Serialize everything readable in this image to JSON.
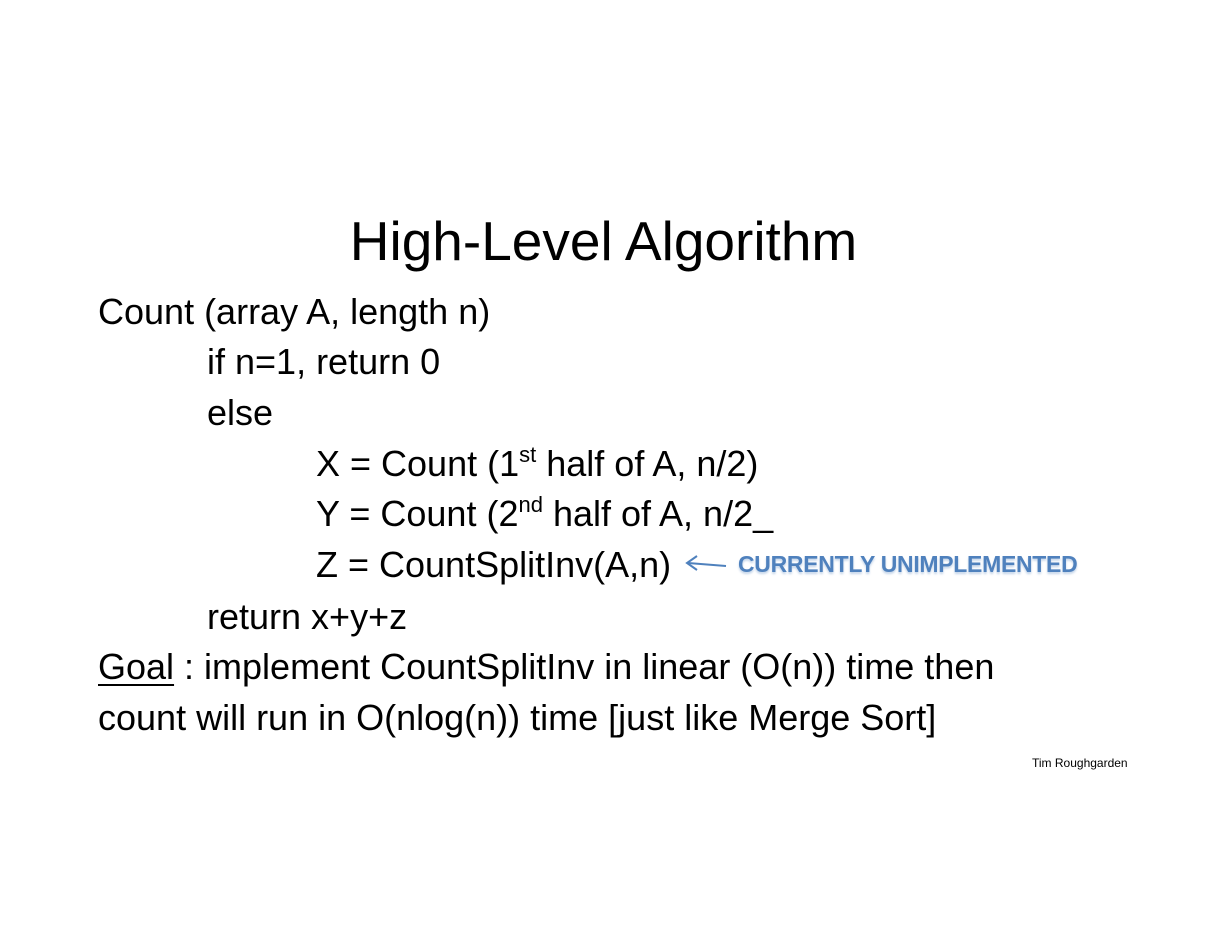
{
  "slide": {
    "title": "High-Level Algorithm",
    "lines": {
      "signature": "Count (array A, length n)",
      "base_case": "if n=1, return 0",
      "else": "else",
      "x_prefix": "X = Count (1",
      "x_sup": "st",
      "x_suffix": " half of A, n/2)",
      "y_prefix": "Y = Count (2",
      "y_sup": "nd",
      "y_suffix": " half of A, n/2_",
      "z_line": "Z = CountSplitInv(A,n)",
      "return_line": "return   x+y+z",
      "goal_word": "Goal",
      "goal_rest": " : implement CountSplitInv in linear (O(n)) time then",
      "goal_line2": "count will run in O(nlog(n)) time [just like Merge Sort]"
    },
    "annotation": {
      "label": "CURRENTLY UNIMPLEMENTED",
      "icon": "left-arrow-icon",
      "color": "#4f81bd"
    },
    "author": "Tim Roughgarden"
  }
}
